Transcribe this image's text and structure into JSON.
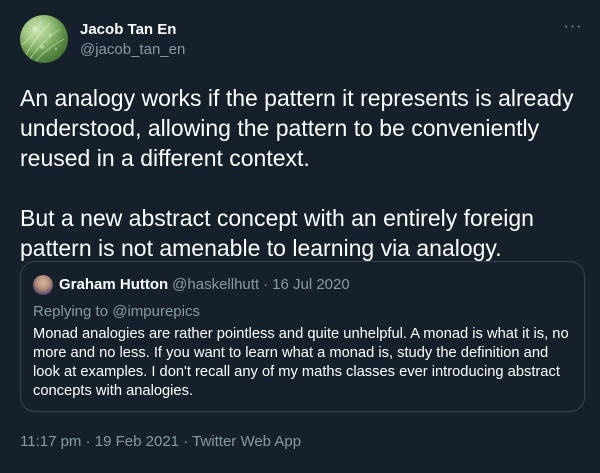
{
  "author": {
    "display_name": "Jacob Tan En",
    "handle": "@jacob_tan_en",
    "avatar_icon": "grass-photo-avatar"
  },
  "menu": {
    "more_glyph": "···",
    "more_icon": "more-horizontal-icon"
  },
  "tweet": {
    "text": "An analogy works if the pattern it represents is already understood, allowing the pattern to be conveniently reused in a different context.\n\nBut a new abstract concept with an entirely foreign pattern is not amenable to learning via analogy."
  },
  "quoted_tweet": {
    "display_name": "Graham Hutton",
    "handle": "@haskellhutt",
    "separator": "·",
    "date": "16 Jul 2020",
    "replying_to": "Replying to @impurepics",
    "text": "Monad analogies are rather pointless and quite unhelpful. A monad is what it is, no more and no less.  If you want to learn what a monad is, study the definition and look at examples.  I don't recall any of my maths classes ever introducing abstract concepts with analogies."
  },
  "meta": {
    "time": "11:17 pm",
    "separator1": "·",
    "date": "19 Feb 2021",
    "separator2": "·",
    "source": "Twitter Web App"
  },
  "colors": {
    "background": "#15202b",
    "text_primary": "#ffffff",
    "text_secondary": "#8899a6",
    "border": "#38444d"
  }
}
